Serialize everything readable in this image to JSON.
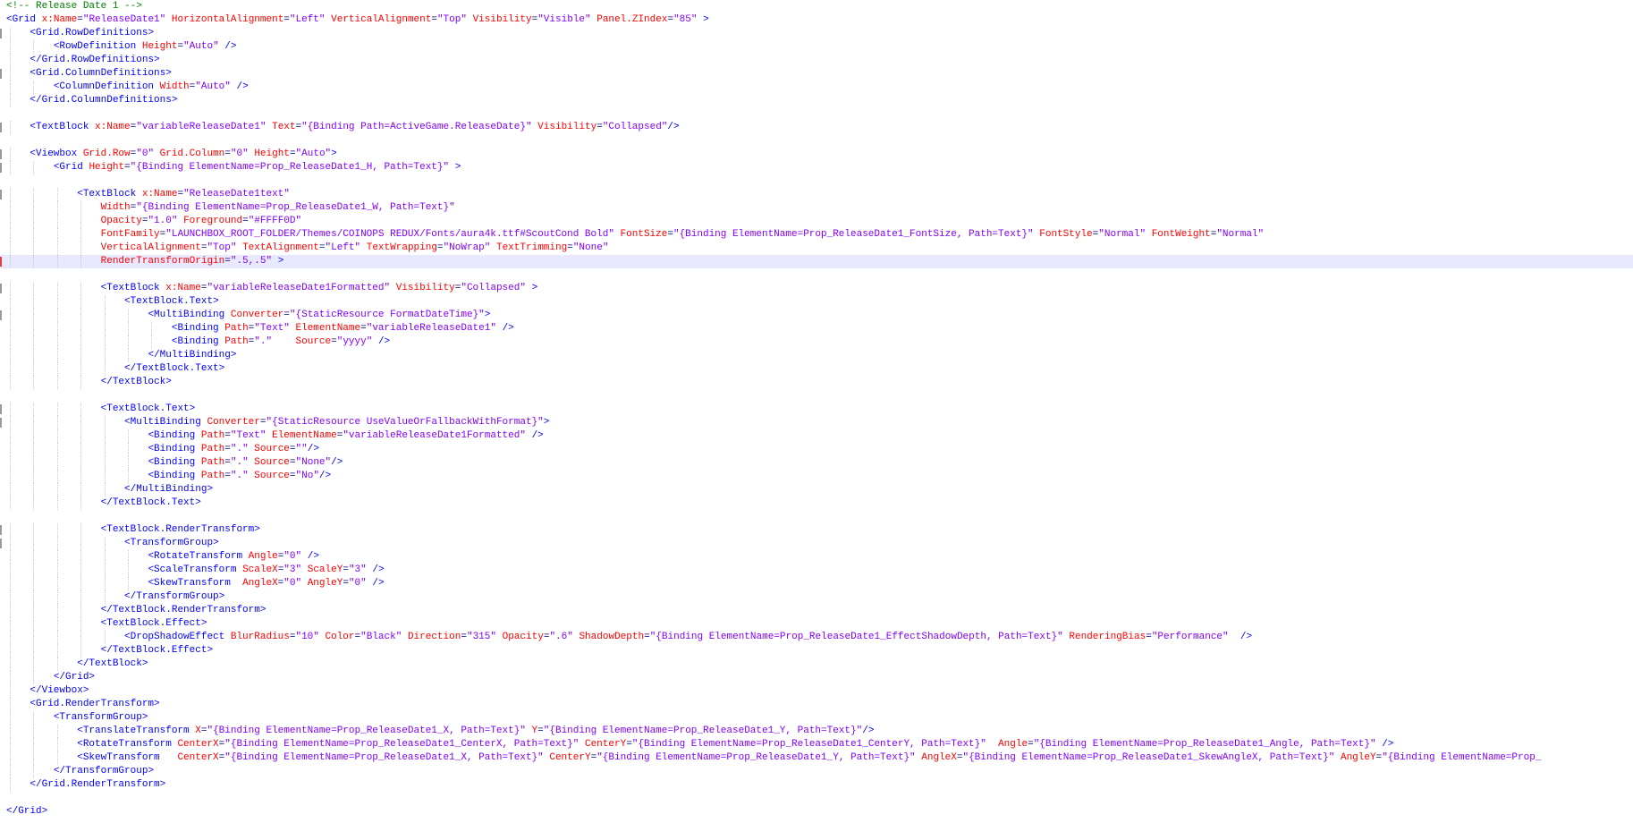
{
  "editor": {
    "colors": {
      "comment": "#008000",
      "tag": "#0000ff",
      "attribute": "#ff0000",
      "value": "#8000ff",
      "current_line": "#e8e8ff"
    },
    "lines": [
      "<!-- Release Date 1 -->",
      "<Grid x:Name=\"ReleaseDate1\" HorizontalAlignment=\"Left\" VerticalAlignment=\"Top\" Visibility=\"Visible\" Panel.ZIndex=\"85\" >",
      "    <Grid.RowDefinitions>",
      "        <RowDefinition Height=\"Auto\" />",
      "    </Grid.RowDefinitions>",
      "    <Grid.ColumnDefinitions>",
      "        <ColumnDefinition Width=\"Auto\" />",
      "    </Grid.ColumnDefinitions>",
      "",
      "    <TextBlock x:Name=\"variableReleaseDate1\" Text=\"{Binding Path=ActiveGame.ReleaseDate}\" Visibility=\"Collapsed\"/>",
      "",
      "    <Viewbox Grid.Row=\"0\" Grid.Column=\"0\" Height=\"Auto\">",
      "        <Grid Height=\"{Binding ElementName=Prop_ReleaseDate1_H, Path=Text}\" >",
      "",
      "            <TextBlock x:Name=\"ReleaseDate1text\"",
      "                Width=\"{Binding ElementName=Prop_ReleaseDate1_W, Path=Text}\"",
      "                Opacity=\"1.0\" Foreground=\"#FFFF0D\"",
      "                FontFamily=\"LAUNCHBOX_ROOT_FOLDER/Themes/COINOPS REDUX/Fonts/aura4k.ttf#ScoutCond Bold\" FontSize=\"{Binding ElementName=Prop_ReleaseDate1_FontSize, Path=Text}\" FontStyle=\"Normal\" FontWeight=\"Normal\"",
      "                VerticalAlignment=\"Top\" TextAlignment=\"Left\" TextWrapping=\"NoWrap\" TextTrimming=\"None\"",
      "                RenderTransformOrigin=\".5,.5\" >",
      "",
      "                <TextBlock x:Name=\"variableReleaseDate1Formatted\" Visibility=\"Collapsed\" >",
      "                    <TextBlock.Text>",
      "                        <MultiBinding Converter=\"{StaticResource FormatDateTime}\">",
      "                            <Binding Path=\"Text\" ElementName=\"variableReleaseDate1\" />",
      "                            <Binding Path=\".\"    Source=\"yyyy\" />",
      "                        </MultiBinding>",
      "                    </TextBlock.Text>",
      "                </TextBlock>",
      "",
      "                <TextBlock.Text>",
      "                    <MultiBinding Converter=\"{StaticResource UseValueOrFallbackWithFormat}\">",
      "                        <Binding Path=\"Text\" ElementName=\"variableReleaseDate1Formatted\" />",
      "                        <Binding Path=\".\" Source=\"\"/>",
      "                        <Binding Path=\".\" Source=\"None\"/>",
      "                        <Binding Path=\".\" Source=\"No\"/>",
      "                    </MultiBinding>",
      "                </TextBlock.Text>",
      "",
      "                <TextBlock.RenderTransform>",
      "                    <TransformGroup>",
      "                        <RotateTransform Angle=\"0\" />",
      "                        <ScaleTransform ScaleX=\"3\" ScaleY=\"3\" />",
      "                        <SkewTransform  AngleX=\"0\" AngleY=\"0\" />",
      "                    </TransformGroup>",
      "                </TextBlock.RenderTransform>",
      "                <TextBlock.Effect>",
      "                    <DropShadowEffect BlurRadius=\"10\" Color=\"Black\" Direction=\"315\" Opacity=\".6\" ShadowDepth=\"{Binding ElementName=Prop_ReleaseDate1_EffectShadowDepth, Path=Text}\" RenderingBias=\"Performance\"  />",
      "                </TextBlock.Effect>",
      "            </TextBlock>",
      "        </Grid>",
      "    </Viewbox>",
      "    <Grid.RenderTransform>",
      "        <TransformGroup>",
      "            <TranslateTransform X=\"{Binding ElementName=Prop_ReleaseDate1_X, Path=Text}\" Y=\"{Binding ElementName=Prop_ReleaseDate1_Y, Path=Text}\"/>",
      "            <RotateTransform CenterX=\"{Binding ElementName=Prop_ReleaseDate1_CenterX, Path=Text}\" CenterY=\"{Binding ElementName=Prop_ReleaseDate1_CenterY, Path=Text}\"  Angle=\"{Binding ElementName=Prop_ReleaseDate1_Angle, Path=Text}\" />",
      "            <SkewTransform   CenterX=\"{Binding ElementName=Prop_ReleaseDate1_X, Path=Text}\" CenterY=\"{Binding ElementName=Prop_ReleaseDate1_Y, Path=Text}\" AngleX=\"{Binding ElementName=Prop_ReleaseDate1_SkewAngleX, Path=Text}\" AngleY=\"{Binding ElementName=Prop_",
      "        </TransformGroup>",
      "    </Grid.RenderTransform>",
      "",
      "</Grid>"
    ]
  }
}
